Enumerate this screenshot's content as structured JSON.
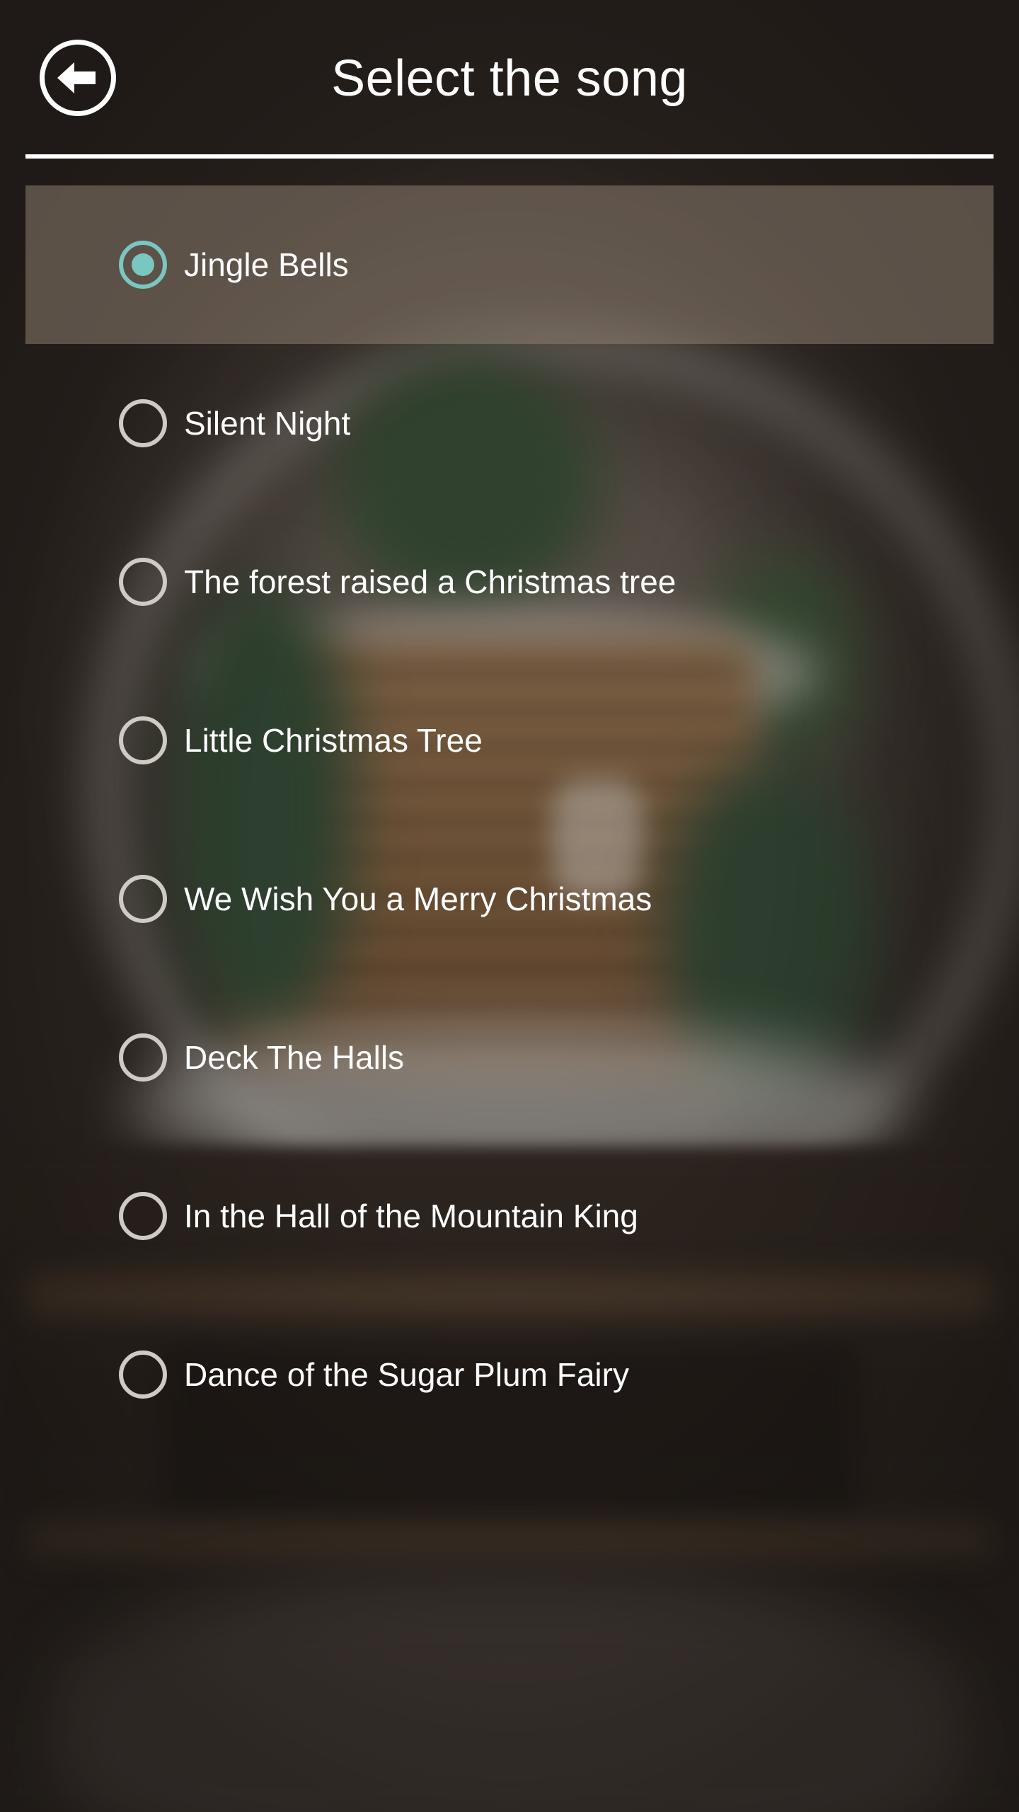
{
  "header": {
    "title": "Select the song",
    "back_icon": "arrow-left-circle-icon"
  },
  "songs": [
    {
      "label": "Jingle Bells",
      "selected": true
    },
    {
      "label": "Silent Night",
      "selected": false
    },
    {
      "label": "The forest raised a Christmas tree",
      "selected": false
    },
    {
      "label": "Little Christmas Tree",
      "selected": false
    },
    {
      "label": "We Wish You a Merry Christmas",
      "selected": false
    },
    {
      "label": "Deck The Halls",
      "selected": false
    },
    {
      "label": "In the Hall of the Mountain King",
      "selected": false
    },
    {
      "label": "Dance of the Sugar Plum Fairy",
      "selected": false
    }
  ],
  "colors": {
    "accent": "#79c7c0",
    "radio_unselected": "#cfcac4",
    "text": "#ffffff"
  }
}
